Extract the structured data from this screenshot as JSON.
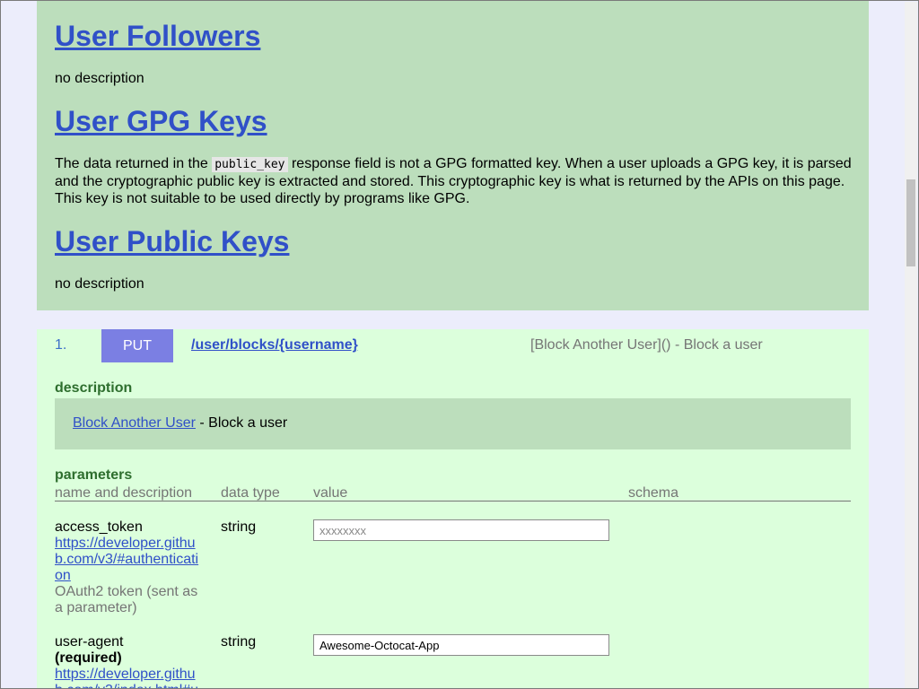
{
  "tags": [
    {
      "title": "User Followers",
      "description": "no description"
    },
    {
      "title": "User GPG Keys",
      "description_before": "The data returned in the",
      "description_code": "public_key",
      "description_after": "response field is not a GPG formatted key. When a user uploads a GPG key, it is parsed and the cryptographic public key is extracted and stored. This cryptographic key is what is returned by the APIs on this page. This key is not suitable to be used directly by programs like GPG."
    },
    {
      "title": "User Public Keys",
      "description": "no description"
    }
  ],
  "operation": {
    "number": "1.",
    "method": "PUT",
    "path": "/user/blocks/{username}",
    "summary": "[Block Another User]() - Block a user",
    "description_label": "description",
    "description_link": "Block Another User",
    "description_text": " - Block a user",
    "parameters_label": "parameters",
    "columns": [
      "name and description",
      "data type",
      "value",
      "schema"
    ],
    "params": [
      {
        "name": "access_token",
        "required": "",
        "link": "https://developer.github.com/v3/#authentication",
        "desc": "OAuth2 token (sent as a parameter)",
        "type": "string",
        "value": "",
        "placeholder": "xxxxxxxx"
      },
      {
        "name": "user-agent",
        "required": "(required)",
        "link": "https://developer.github.com/v3/index.html#u",
        "desc": "",
        "type": "string",
        "value": "Awesome-Octocat-App",
        "placeholder": ""
      }
    ]
  }
}
